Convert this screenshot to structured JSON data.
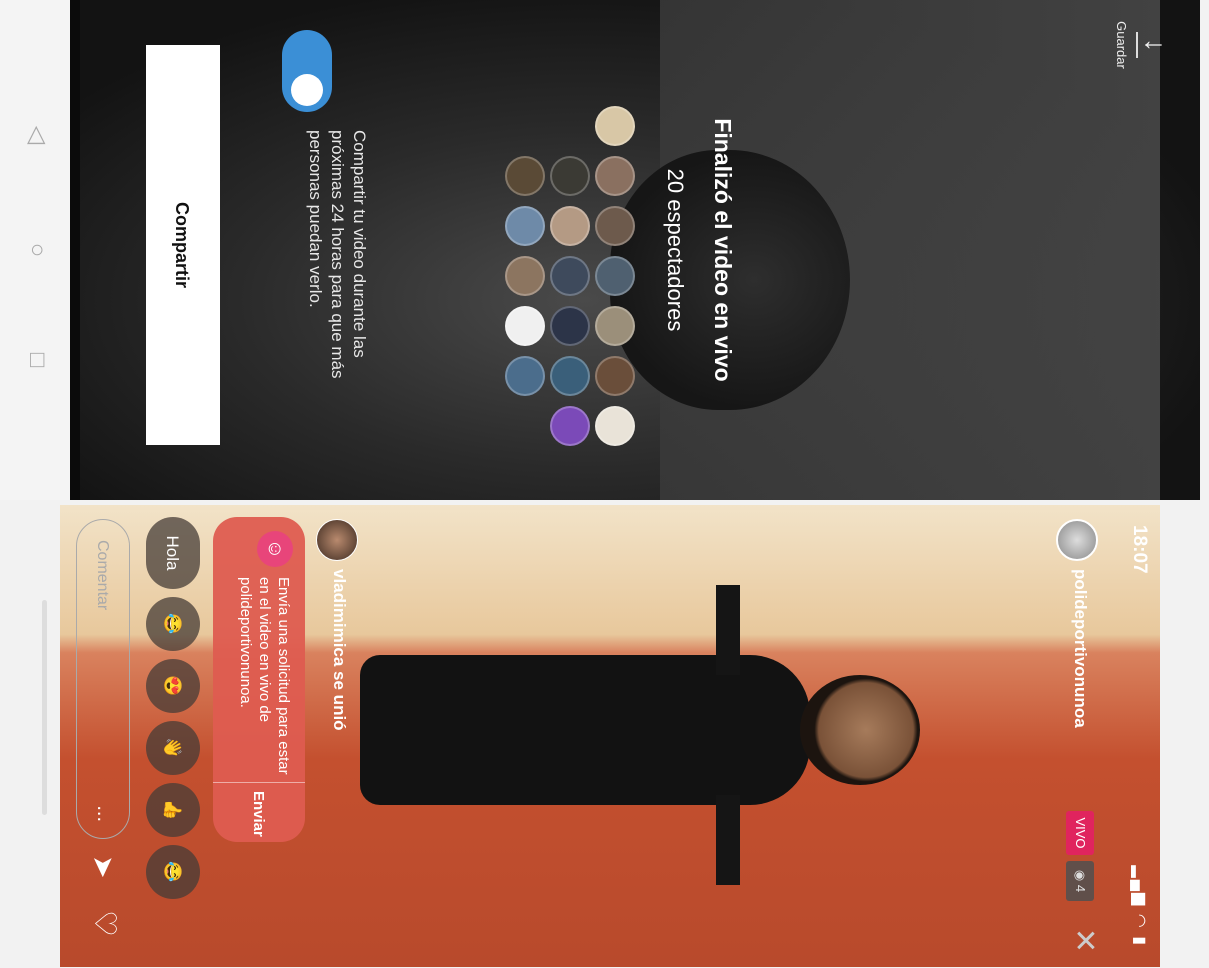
{
  "ended_screen": {
    "save_label": "Guardar",
    "title": "Finalizó el video en vivo",
    "viewers_label": "20 espectadores",
    "share_description": "Compartir tu video durante las próximas 24 horas para que más personas puedan verlo.",
    "share_toggle_on": true,
    "share_button": "Compartir",
    "nav": [
      "back-icon",
      "home-icon",
      "recents-icon"
    ]
  },
  "live_screen": {
    "time": "18:07",
    "host_username": "polideportivonunoa",
    "live_badge": "VIVO",
    "viewer_count": "4",
    "joined_message": "vladimimica se unió",
    "request": {
      "text": "Envía una solicitud para estar en el video en vivo de polideportivonunoa.",
      "send_label": "Enviar"
    },
    "quick_replies": [
      "Hola",
      "😂",
      "😍",
      "👋",
      "👍",
      "😂"
    ],
    "comment_placeholder": "Comentar",
    "more_label": "..."
  },
  "colors": {
    "live_badge": "#e0245e",
    "toggle": "#3b8fd6",
    "request_card": "#de5c50"
  }
}
